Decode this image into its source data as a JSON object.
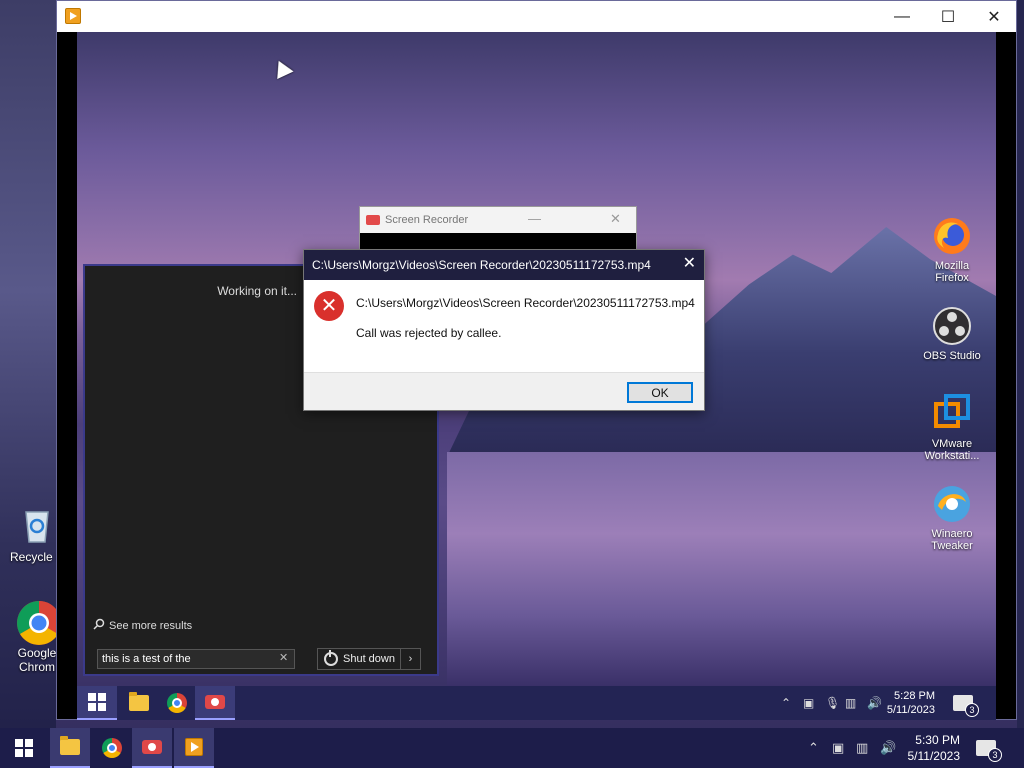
{
  "outer_desktop": {
    "icons": [
      {
        "label": "Recycle B"
      },
      {
        "label": "Google Chrom"
      }
    ]
  },
  "vm_window": {
    "controls": {
      "minimize": "—",
      "maximize": "☐",
      "close": "✕"
    }
  },
  "inner_desktop": {
    "icons": [
      {
        "label": "Mozilla Firefox"
      },
      {
        "label": "OBS Studio"
      },
      {
        "label": "VMware Workstati..."
      },
      {
        "label": "Winaero Tweaker"
      }
    ]
  },
  "search_panel": {
    "working_text": "Working on it...",
    "see_more": "See more results",
    "search_value": "this is a test of the",
    "shutdown_label": "Shut down"
  },
  "recorder_window": {
    "title": "Screen Recorder"
  },
  "dialog": {
    "title": "C:\\Users\\Morgz\\Videos\\Screen Recorder\\20230511172753.mp4",
    "path": "C:\\Users\\Morgz\\Videos\\Screen Recorder\\20230511172753.mp4",
    "message": "Call was rejected by callee.",
    "ok_label": "OK"
  },
  "inner_taskbar": {
    "time": "5:28 PM",
    "date": "5/11/2023",
    "notification_count": "3"
  },
  "outer_taskbar": {
    "time": "5:30 PM",
    "date": "5/11/2023",
    "notification_count": "3"
  },
  "colors": {
    "taskbar": "#1d1d4a",
    "dialog_title": "#1f1f3f",
    "error_red": "#d9302c",
    "ok_border": "#0078d7"
  }
}
